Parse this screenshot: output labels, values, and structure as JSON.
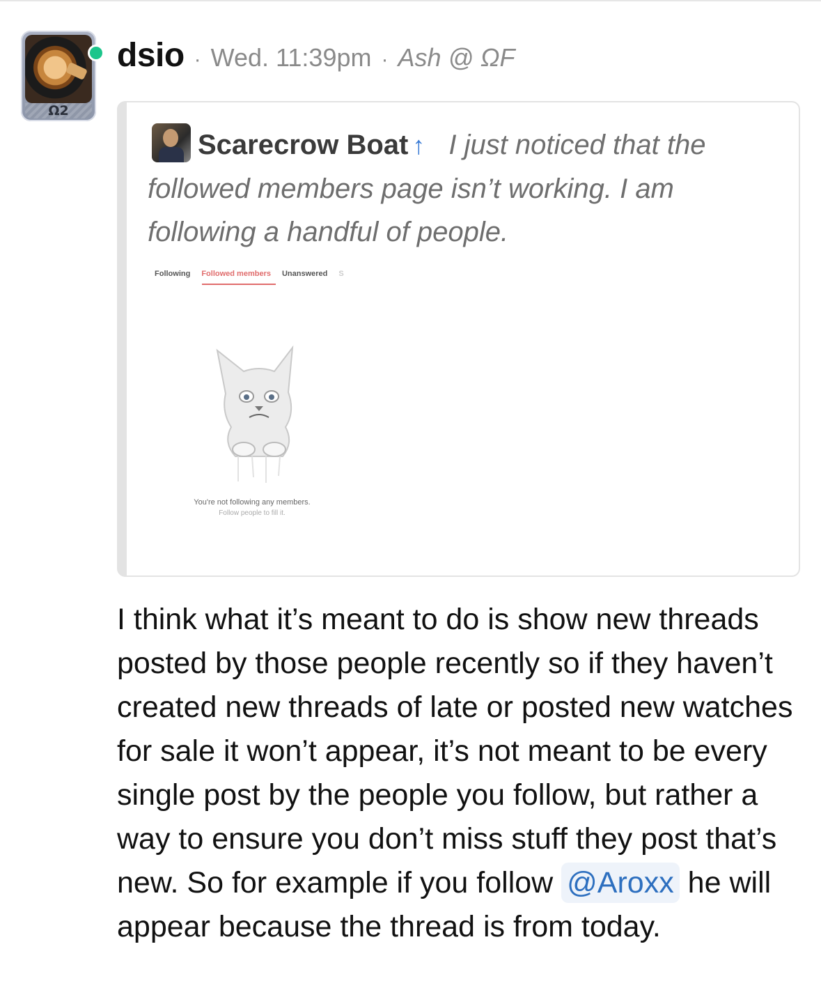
{
  "post": {
    "username": "dsio",
    "sep": "·",
    "timestamp": "Wed. 11:39pm",
    "forum": "Ash @ ΩF",
    "avatar_badge": "Ω2",
    "status_color": "#1cc58b"
  },
  "quote": {
    "author": "Scarecrow Boat",
    "arrow_icon": "↑",
    "text": "I just noticed that the followed members page isn’t working. I am following a handful of people.",
    "embed": {
      "tabs": [
        "Following",
        "Followed members",
        "Unanswered",
        "S"
      ],
      "active_tab": "Followed members",
      "empty_title": "You're not following any members.",
      "empty_subtitle": "Follow people to fill it."
    }
  },
  "body": {
    "part1": "I think what it’s meant to do is show new threads posted by those people recently so if they haven’t created new threads of late or posted new watches for sale it won’t appear, it’s not meant to be every single post by the people you follow, but rather a way to ensure you don’t miss stuff they post that’s new. So for example if you follow ",
    "mention": "@Aroxx",
    "part2": " he will appear because the thread is from today."
  },
  "colors": {
    "accent": "#2d6fbf",
    "muted": "#8a8a8a",
    "quote_border": "#e3e3e3"
  }
}
